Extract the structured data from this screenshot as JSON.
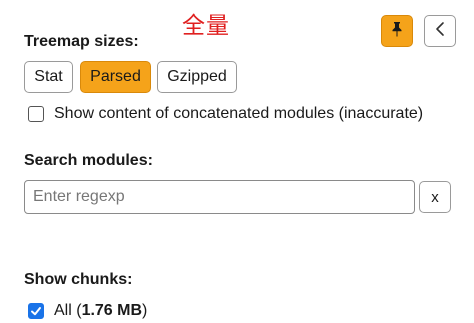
{
  "annotation": "全量",
  "icons": {
    "pin": "pushpin-icon",
    "collapse": "chevron-left-icon"
  },
  "colors": {
    "accent": "#f5a31a",
    "checkbox": "#1a73e8",
    "annotation": "#e02020"
  },
  "treemap": {
    "label": "Treemap sizes:",
    "options": [
      "Stat",
      "Parsed",
      "Gzipped"
    ],
    "selected": "Parsed",
    "concat_label": "Show content of concatenated modules (inaccurate)",
    "concat_checked": false
  },
  "search": {
    "label": "Search modules:",
    "placeholder": "Enter regexp",
    "value": "",
    "clear_label": "x"
  },
  "chunks": {
    "label": "Show chunks:",
    "all_label": "All (",
    "all_size": "1.76 MB",
    "all_close": ")",
    "all_checked": true
  }
}
